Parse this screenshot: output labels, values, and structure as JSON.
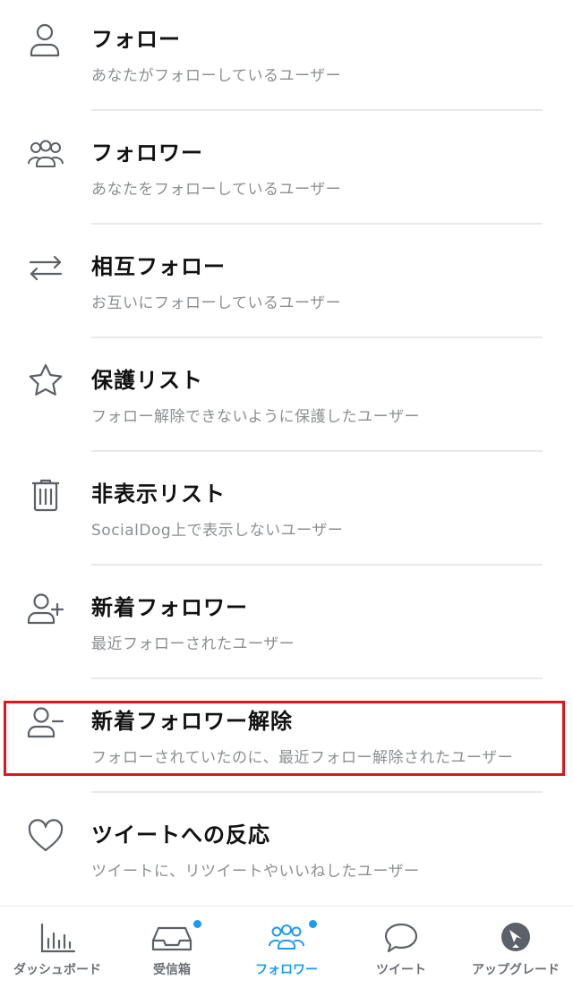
{
  "menu": {
    "items": [
      {
        "title": "フォロー",
        "desc": "あなたがフォローしているユーザー",
        "icon": "user-icon"
      },
      {
        "title": "フォロワー",
        "desc": "あなたをフォローしているユーザー",
        "icon": "users-group-icon"
      },
      {
        "title": "相互フォロー",
        "desc": "お互いにフォローしているユーザー",
        "icon": "arrows-swap-icon"
      },
      {
        "title": "保護リスト",
        "desc": "フォロー解除できないように保護したユーザー",
        "icon": "star-icon"
      },
      {
        "title": "非表示リスト",
        "desc": "SocialDog上で表示しないユーザー",
        "icon": "trash-icon"
      },
      {
        "title": "新着フォロワー",
        "desc": "最近フォローされたユーザー",
        "icon": "user-plus-icon"
      },
      {
        "title": "新着フォロワー解除",
        "desc": "フォローされていたのに、最近フォロー解除されたユーザー",
        "icon": "user-minus-icon"
      },
      {
        "title": "ツイートへの反応",
        "desc": "ツイートに、リツイートやいいねしたユーザー",
        "icon": "heart-icon"
      }
    ]
  },
  "highlight": {
    "item": "新着フォロワー解除",
    "color": "#e0141e"
  },
  "tabbar": {
    "tabs": [
      {
        "label": "ダッシュボード",
        "icon": "bar-chart-icon",
        "active": false,
        "badge": false
      },
      {
        "label": "受信箱",
        "icon": "inbox-icon",
        "active": false,
        "badge": true
      },
      {
        "label": "フォロワー",
        "icon": "users-group-icon",
        "active": true,
        "badge": true
      },
      {
        "label": "ツイート",
        "icon": "speech-bubble-icon",
        "active": false,
        "badge": false
      },
      {
        "label": "アップグレード",
        "icon": "dog-logo-icon",
        "active": false,
        "badge": false
      }
    ]
  },
  "colors": {
    "accent": "#1d9bf0",
    "icon": "#5b6168",
    "divider": "#e7e9eb",
    "desc": "#8b8f94"
  }
}
